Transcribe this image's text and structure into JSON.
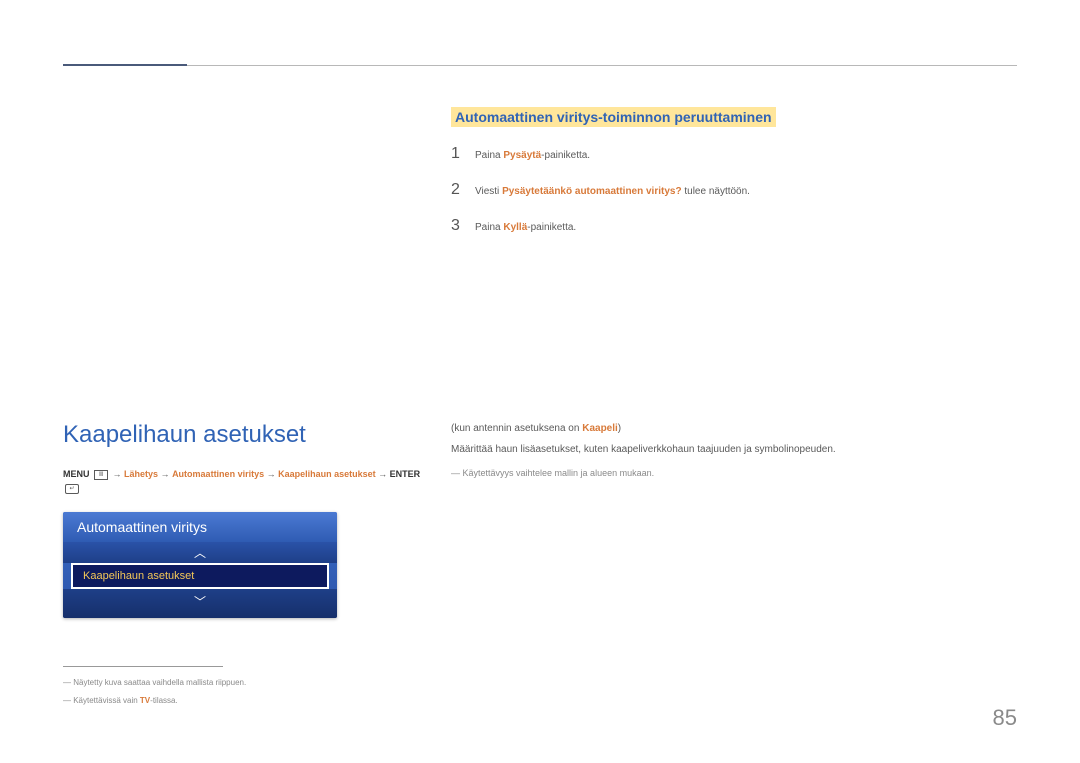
{
  "page": {
    "number": "85"
  },
  "right_top": {
    "heading": "Automaattinen viritys-toiminnon peruuttaminen",
    "items": [
      {
        "num": "1",
        "pre": "Paina ",
        "orange": "Pysäytä",
        "post": "-painiketta."
      },
      {
        "num": "2",
        "pre": "Viesti ",
        "orange": "Pysäytetäänkö automaattinen viritys?",
        "post": " tulee näyttöön."
      },
      {
        "num": "3",
        "pre": "Paina ",
        "orange": "Kyllä",
        "post": "-painiketta."
      }
    ]
  },
  "left": {
    "title": "Kaapelihaun asetukset",
    "menu_label": "MENU",
    "arrow": " → ",
    "path_lahetys": "Lähetys",
    "path_auto": "Automaattinen viritys",
    "path_kaapeli": "Kaapelihaun asetukset",
    "enter_label": "ENTER",
    "ui": {
      "header": "Automaattinen viritys",
      "selected": "Kaapelihaun asetukset",
      "arrow_up": "︿",
      "arrow_down": "﹀"
    }
  },
  "footnotes": {
    "f1": "― Näytetty kuva saattaa vaihdella mallista riippuen.",
    "f2_pre": "― Käytettävissä vain ",
    "f2_orange": "TV",
    "f2_post": "-tilassa."
  },
  "lower_right": {
    "paren_pre": "(kun antennin asetuksena on ",
    "paren_orange": "Kaapeli",
    "paren_post": ")",
    "body": "Määrittää haun lisäasetukset, kuten kaapeliverkkohaun taajuuden ja symbolinopeuden.",
    "note": "― Käytettävyys vaihtelee mallin ja alueen mukaan."
  }
}
